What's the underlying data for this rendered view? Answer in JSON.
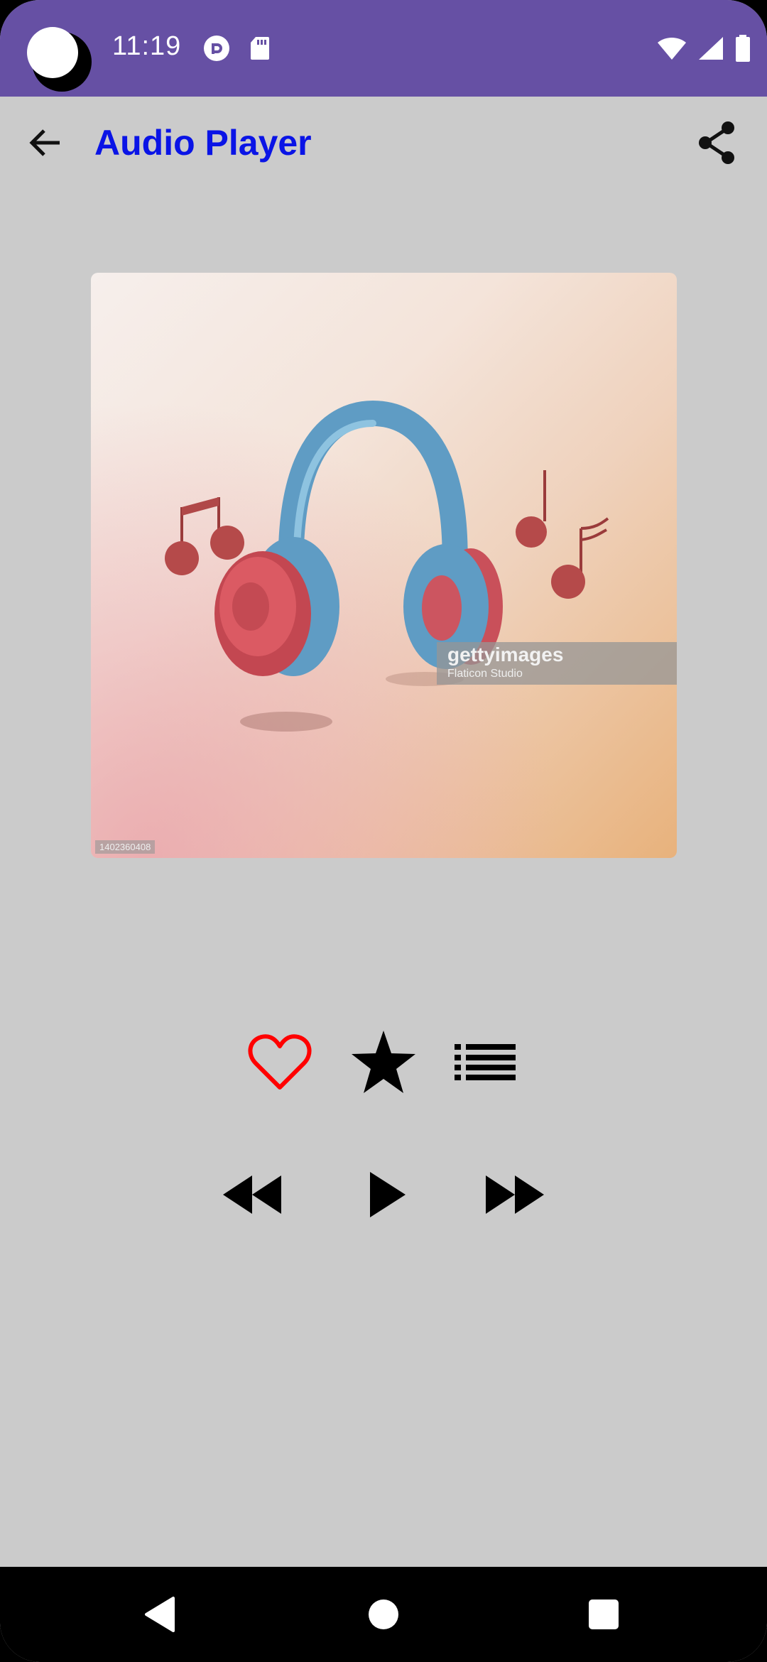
{
  "status_bar": {
    "time": "11:19",
    "background_color": "#6650a4",
    "left_icons": [
      "pocket-casts-icon",
      "sd-card-icon"
    ],
    "right_icons": [
      "wifi-icon",
      "signal-icon",
      "battery-icon"
    ]
  },
  "app_bar": {
    "title": "Audio Player",
    "title_color": "#0a14e6",
    "back_icon": "arrow-back-icon",
    "share_icon": "share-icon"
  },
  "album_art": {
    "watermark": "gettyimages",
    "credit": "Flaticon Studio",
    "image_id": "1402360408"
  },
  "actions": {
    "favorite_icon": "heart-outline-icon",
    "favorite_color": "#ff0000",
    "rate_icon": "star-icon",
    "playlist_icon": "list-icon"
  },
  "playback": {
    "rewind_icon": "rewind-icon",
    "play_icon": "play-icon",
    "fast_forward_icon": "fast-forward-icon"
  },
  "nav_bar": {
    "back_icon": "nav-back-icon",
    "home_icon": "nav-home-icon",
    "recents_icon": "nav-recents-icon"
  }
}
